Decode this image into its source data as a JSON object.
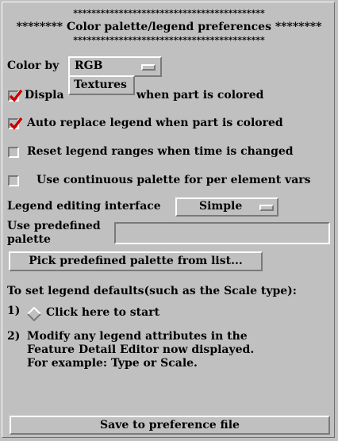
{
  "header": {
    "stars_line": "******************************************",
    "title": "******** Color palette/legend preferences ********"
  },
  "color_by": {
    "label": "Color by",
    "value": "RGB",
    "dropdown_option": "Textures"
  },
  "options": [
    {
      "label": "Display legend when part is colored",
      "visible_label": "Displa",
      "visible_suffix": "when part is colored",
      "checked": true
    },
    {
      "label": "Auto replace legend when part is colored",
      "checked": true
    },
    {
      "label": "Reset legend ranges when time is changed",
      "checked": false
    },
    {
      "label": "Use continuous palette for per element vars",
      "checked": false
    }
  ],
  "legend_editing": {
    "label": "Legend editing interface",
    "value": "Simple"
  },
  "predefined": {
    "label_line1": "Use predefined",
    "label_line2": "palette",
    "value": "",
    "pick_button": "Pick predefined palette from list..."
  },
  "instructions": {
    "heading": "To set legend defaults(such as the Scale type):",
    "step1_num": "1)",
    "step1_label": "Click here to start",
    "step2_num": "2)",
    "step2_line1": "Modify any legend attributes in the",
    "step2_line2": "Feature Detail Editor now displayed.",
    "step2_line3": "For example: Type or Scale."
  },
  "footer": {
    "save_button": "Save to preference file"
  },
  "colors": {
    "background": "#c0c0c0",
    "check_mark": "#cc0000"
  },
  "icons": [
    "check-mark-icon",
    "option-menu-indicator-icon",
    "diamond-radio-icon"
  ]
}
